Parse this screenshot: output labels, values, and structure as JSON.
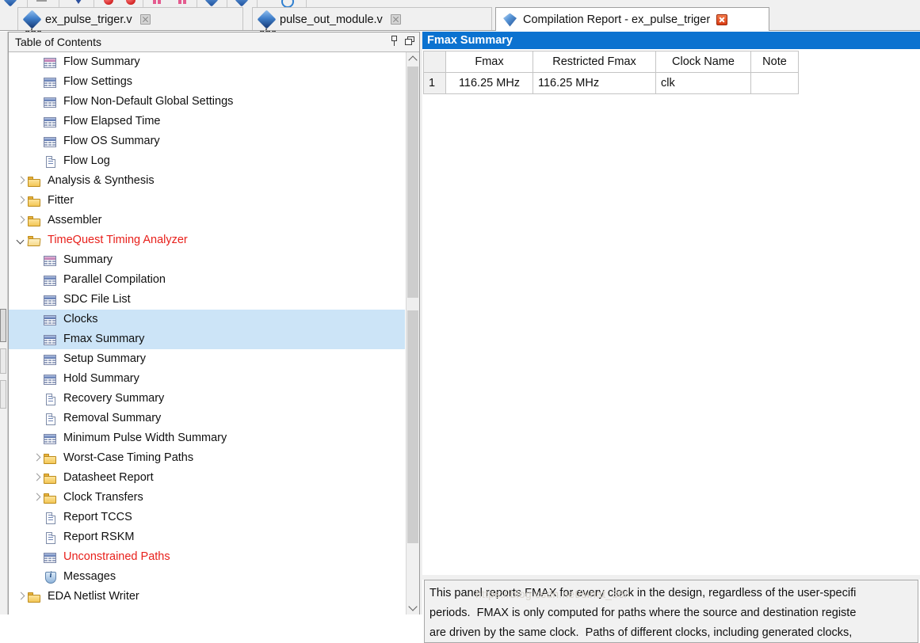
{
  "toolbar": {
    "icons": [
      "diamond-icon",
      "dash-icon",
      "blue-arrow-icon",
      "red-ball-icon",
      "red-circle-icon",
      "pink-bars-icon",
      "pink-bars2-icon",
      "diamond2-icon",
      "diamond3-icon",
      "blue-circle-icon"
    ]
  },
  "tabs": [
    {
      "label": "ex_pulse_triger.v",
      "icon": "verilog-file-icon",
      "close": "close-icon",
      "active": false
    },
    {
      "label": "pulse_out_module.v",
      "icon": "verilog-file-icon",
      "close": "close-icon",
      "active": false
    },
    {
      "label": "Compilation Report - ex_pulse_triger",
      "icon": "compilation-report-icon",
      "close": "close-icon",
      "active": true
    }
  ],
  "toc": {
    "title": "Table of Contents",
    "pin_icon": "pin-icon",
    "restore_icon": "restore-icon",
    "items": [
      {
        "label": "Flow Summary",
        "icon": "table-pink-icon",
        "indent": 1,
        "twisty": "",
        "state": ""
      },
      {
        "label": "Flow Settings",
        "icon": "table-blue-icon",
        "indent": 1,
        "twisty": "",
        "state": ""
      },
      {
        "label": "Flow Non-Default Global Settings",
        "icon": "table-blue-icon",
        "indent": 1,
        "twisty": "",
        "state": ""
      },
      {
        "label": "Flow Elapsed Time",
        "icon": "table-blue-icon",
        "indent": 1,
        "twisty": "",
        "state": ""
      },
      {
        "label": "Flow OS Summary",
        "icon": "table-blue-icon",
        "indent": 1,
        "twisty": "",
        "state": ""
      },
      {
        "label": "Flow Log",
        "icon": "document-icon",
        "indent": 1,
        "twisty": "",
        "state": ""
      },
      {
        "label": "Analysis & Synthesis",
        "icon": "folder-icon",
        "indent": 0,
        "twisty": "closed",
        "state": ""
      },
      {
        "label": "Fitter",
        "icon": "folder-icon",
        "indent": 0,
        "twisty": "closed",
        "state": ""
      },
      {
        "label": "Assembler",
        "icon": "folder-icon",
        "indent": 0,
        "twisty": "closed",
        "state": ""
      },
      {
        "label": "TimeQuest Timing Analyzer",
        "icon": "folder-open-icon",
        "indent": 0,
        "twisty": "open",
        "state": "red"
      },
      {
        "label": "Summary",
        "icon": "table-pink-icon",
        "indent": 1,
        "twisty": "",
        "state": ""
      },
      {
        "label": "Parallel Compilation",
        "icon": "table-blue-icon",
        "indent": 1,
        "twisty": "",
        "state": ""
      },
      {
        "label": "SDC File List",
        "icon": "table-blue-icon",
        "indent": 1,
        "twisty": "",
        "state": ""
      },
      {
        "label": "Clocks",
        "icon": "table-blue-icon",
        "indent": 1,
        "twisty": "",
        "state": "sel"
      },
      {
        "label": "Fmax Summary",
        "icon": "table-blue-icon",
        "indent": 1,
        "twisty": "",
        "state": "sel"
      },
      {
        "label": "Setup Summary",
        "icon": "table-blue-icon",
        "indent": 1,
        "twisty": "",
        "state": ""
      },
      {
        "label": "Hold Summary",
        "icon": "table-blue-icon",
        "indent": 1,
        "twisty": "",
        "state": ""
      },
      {
        "label": "Recovery Summary",
        "icon": "document-icon",
        "indent": 1,
        "twisty": "",
        "state": ""
      },
      {
        "label": "Removal Summary",
        "icon": "document-icon",
        "indent": 1,
        "twisty": "",
        "state": ""
      },
      {
        "label": "Minimum Pulse Width Summary",
        "icon": "table-blue-icon",
        "indent": 1,
        "twisty": "",
        "state": ""
      },
      {
        "label": "Worst-Case Timing Paths",
        "icon": "folder-icon",
        "indent": 1,
        "twisty": "closed",
        "state": ""
      },
      {
        "label": "Datasheet Report",
        "icon": "folder-icon",
        "indent": 1,
        "twisty": "closed",
        "state": ""
      },
      {
        "label": "Clock Transfers",
        "icon": "folder-icon",
        "indent": 1,
        "twisty": "closed",
        "state": ""
      },
      {
        "label": "Report TCCS",
        "icon": "document-icon",
        "indent": 1,
        "twisty": "",
        "state": ""
      },
      {
        "label": "Report RSKM",
        "icon": "document-icon",
        "indent": 1,
        "twisty": "",
        "state": ""
      },
      {
        "label": "Unconstrained Paths",
        "icon": "table-blue-icon",
        "indent": 1,
        "twisty": "",
        "state": "red"
      },
      {
        "label": "Messages",
        "icon": "info-icon",
        "indent": 1,
        "twisty": "",
        "state": ""
      },
      {
        "label": "EDA Netlist Writer",
        "icon": "folder-icon",
        "indent": 0,
        "twisty": "closed",
        "state": ""
      }
    ]
  },
  "report": {
    "title": "Fmax Summary",
    "columns": [
      "",
      "Fmax",
      "Restricted Fmax",
      "Clock Name",
      "Note"
    ],
    "rows": [
      {
        "num": "1",
        "fmax": "116.25 MHz",
        "restricted_fmax": "116.25 MHz",
        "clock_name": "clk",
        "note": ""
      }
    ],
    "description": "This panel reports FMAX for every clock in the design, regardless of the user-specifi\nperiods.  FMAX is only computed for paths where the source and destination registe\nare driven by the same clock.  Paths of different clocks, including generated clocks, ",
    "watermark": "https://blog.csdn.net/sinat_36/"
  },
  "colors": {
    "title_bar": "#0b72d0",
    "selection": "#cce4f7",
    "red_text": "#e8201b",
    "folder": "#f3c757"
  }
}
